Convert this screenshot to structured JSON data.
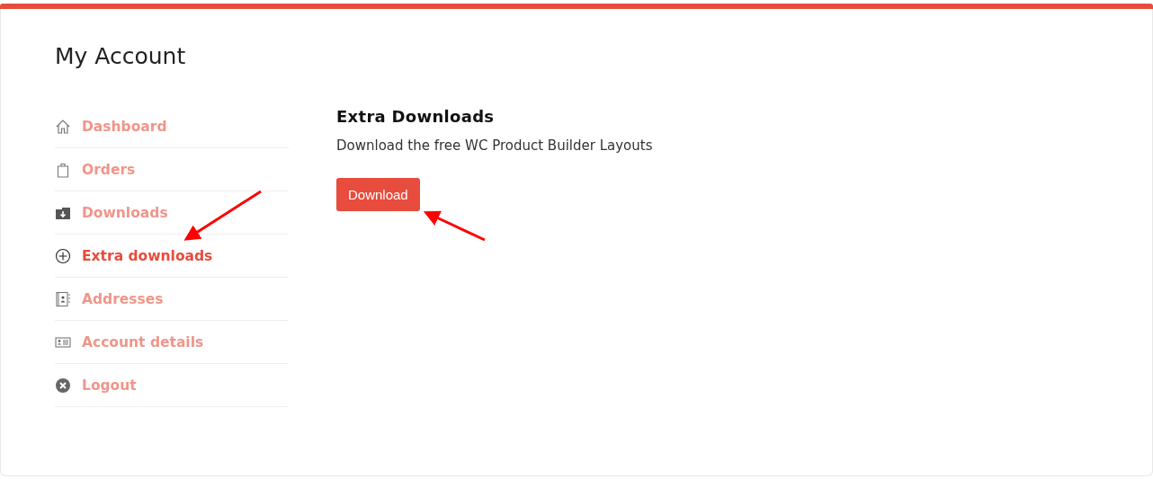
{
  "page": {
    "title": "My Account"
  },
  "nav": [
    {
      "label": "Dashboard",
      "kind": "home",
      "selected": false
    },
    {
      "label": "Orders",
      "kind": "bag",
      "selected": false
    },
    {
      "label": "Downloads",
      "kind": "download",
      "selected": false
    },
    {
      "label": "Extra downloads",
      "kind": "plus",
      "selected": true
    },
    {
      "label": "Addresses",
      "kind": "book",
      "selected": false
    },
    {
      "label": "Account details",
      "kind": "card",
      "selected": false
    },
    {
      "label": "Logout",
      "kind": "logout",
      "selected": false
    }
  ],
  "content": {
    "heading": "Extra Downloads",
    "text": "Download the free WC Product Builder Layouts",
    "button": "Download"
  }
}
